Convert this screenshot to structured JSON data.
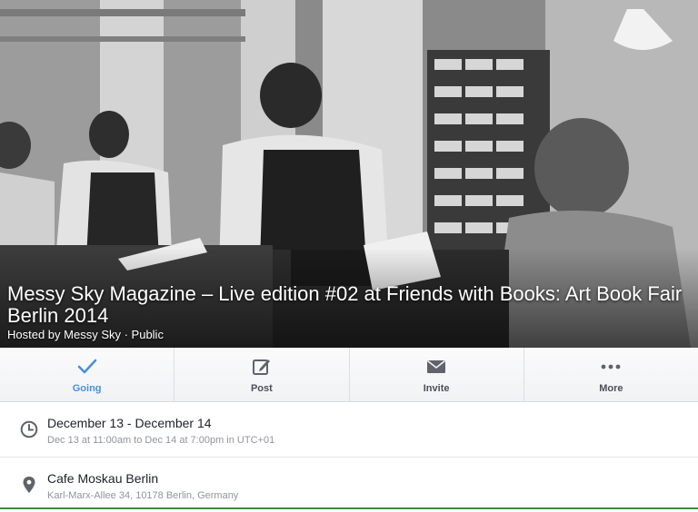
{
  "event": {
    "title": "Messy Sky Magazine – Live edition #02 at Friends with Books: Art Book Fair Berlin 2014",
    "hosted_by": "Hosted by Messy Sky · Public"
  },
  "actions": [
    {
      "label": "Going",
      "icon": "checkmark-icon",
      "active": true
    },
    {
      "label": "Post",
      "icon": "compose-icon"
    },
    {
      "label": "Invite",
      "icon": "envelope-icon"
    },
    {
      "label": "More",
      "icon": "ellipsis-icon"
    }
  ],
  "details": {
    "date": {
      "main": "December 13 - December 14",
      "sub": "Dec 13 at 11:00am to Dec 14 at 7:00pm in UTC+01",
      "icon": "clock-icon"
    },
    "location": {
      "main": "Cafe Moskau Berlin",
      "sub": "Karl-Marx-Allee 34, 10178 Berlin, Germany",
      "icon": "map-pin-icon"
    }
  },
  "colors": {
    "accent": "#4a90d9",
    "icon_gray": "#5f636b"
  }
}
